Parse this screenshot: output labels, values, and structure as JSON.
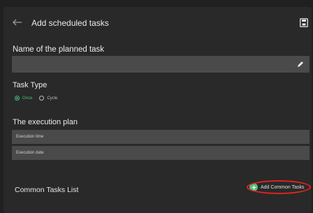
{
  "header": {
    "title": "Add scheduled tasks",
    "back_icon": "arrow-left-icon",
    "save_icon": "save-icon"
  },
  "form": {
    "name_label": "Name of the planned task",
    "name_value": "",
    "task_type_label": "Task Type",
    "task_types": [
      {
        "label": "Once",
        "selected": true
      },
      {
        "label": "Cycle",
        "selected": false
      }
    ],
    "plan_label": "The execution plan",
    "execution_time": "Execution time",
    "execution_date": "Execution date"
  },
  "common": {
    "label": "Common Tasks List",
    "add_label": "Add Common Tasks"
  },
  "colors": {
    "accent": "#4ac07b",
    "highlight": "#e0231f",
    "background": "#292929",
    "field": "#4a4a4a"
  }
}
